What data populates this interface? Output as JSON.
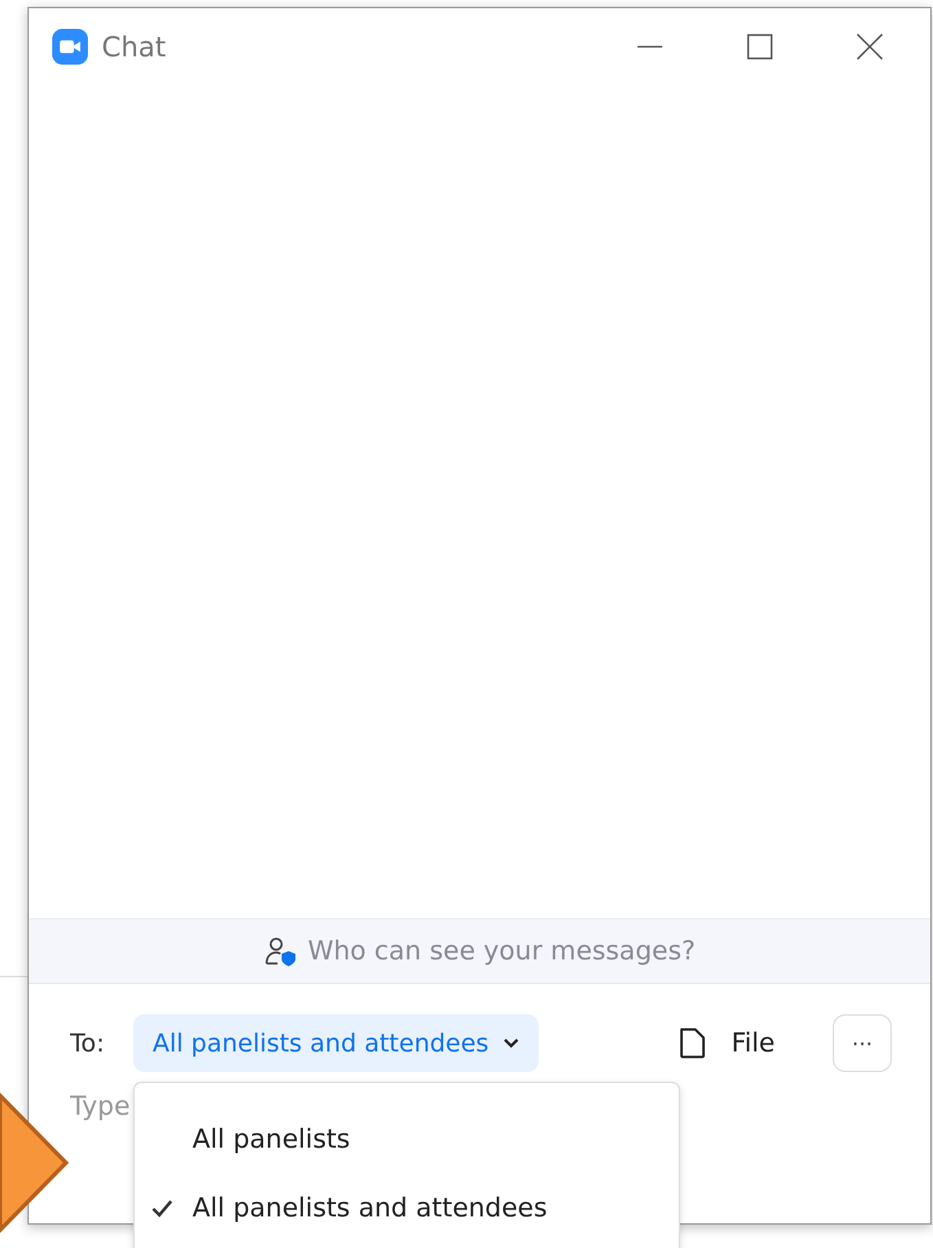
{
  "window": {
    "title": "Chat"
  },
  "privacy_notice": {
    "text": "Who can see your messages?"
  },
  "compose": {
    "to_label": "To:",
    "recipient": "All panelists and attendees",
    "file_button": "File",
    "more_button": "···",
    "placeholder": "Type"
  },
  "recipient_menu": [
    {
      "label": "All panelists",
      "selected": false
    },
    {
      "label": "All panelists and attendees",
      "selected": true
    }
  ]
}
